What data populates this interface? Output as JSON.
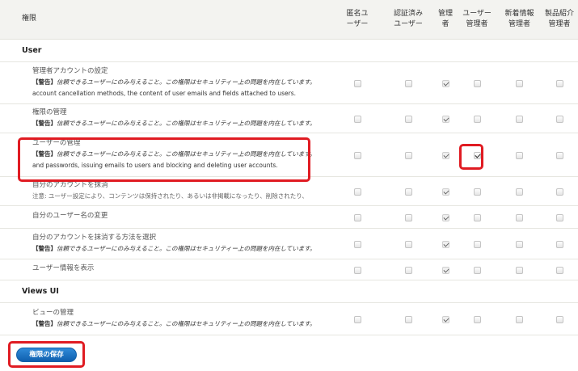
{
  "header": {
    "permission_label": "権限",
    "roles": [
      "匿名ユーザー",
      "認証済みユーザー",
      "管理者",
      "ユーザー管理者",
      "新着情報管理者",
      "製品紹介管理者"
    ]
  },
  "sections": [
    {
      "title": "User",
      "rows": [
        {
          "title": "管理者アカウントの設定",
          "warn_label": "【警告】",
          "warn_text": "信頼できるユーザーにのみ与えること。この権限はセキュリティー上の問題を内在しています。",
          "extra": "account cancellation methods, the content of user emails and fields attached to users.",
          "checks": [
            false,
            false,
            true,
            false,
            false,
            false
          ],
          "disabled": [
            false,
            false,
            true,
            false,
            false,
            false
          ]
        },
        {
          "title": "権限の管理",
          "warn_label": "【警告】",
          "warn_text": "信頼できるユーザーにのみ与えること。この権限はセキュリティー上の問題を内在しています。",
          "checks": [
            false,
            false,
            true,
            false,
            false,
            false
          ],
          "disabled": [
            false,
            false,
            true,
            false,
            false,
            false
          ]
        },
        {
          "title": "ユーザーの管理",
          "warn_label": "【警告】",
          "warn_text": "信頼できるユーザーにのみ与えること。この権限はセキュリティー上の問題を内在しています。",
          "extra": "and passwords, issuing emails to users and blocking and deleting user accounts.",
          "checks": [
            false,
            false,
            true,
            true,
            false,
            false
          ],
          "disabled": [
            false,
            false,
            true,
            false,
            false,
            false
          ]
        },
        {
          "title": "自分のアカウントを抹消",
          "note": "注意: ユーザー設定により、コンテンツは保持されたり、あるいは非掲載になったり、削除されたり、",
          "checks": [
            false,
            false,
            true,
            false,
            false,
            false
          ],
          "disabled": [
            false,
            false,
            true,
            false,
            false,
            false
          ]
        },
        {
          "title": "自分のユーザー名の変更",
          "checks": [
            false,
            false,
            true,
            false,
            false,
            false
          ],
          "disabled": [
            false,
            false,
            true,
            false,
            false,
            false
          ]
        },
        {
          "title": "自分のアカウントを抹消する方法を選択",
          "warn_label": "【警告】",
          "warn_text": "信頼できるユーザーにのみ与えること。この権限はセキュリティー上の問題を内在しています。",
          "checks": [
            false,
            false,
            true,
            false,
            false,
            false
          ],
          "disabled": [
            false,
            false,
            true,
            false,
            false,
            false
          ]
        },
        {
          "title": "ユーザー情報を表示",
          "checks": [
            false,
            false,
            true,
            false,
            false,
            false
          ],
          "disabled": [
            false,
            false,
            true,
            false,
            false,
            false
          ]
        }
      ]
    },
    {
      "title": "Views UI",
      "rows": [
        {
          "title": "ビューの管理",
          "warn_label": "【警告】",
          "warn_text": "信頼できるユーザーにのみ与えること。この権限はセキュリティー上の問題を内在しています。",
          "checks": [
            false,
            false,
            true,
            false,
            false,
            false
          ],
          "disabled": [
            false,
            false,
            true,
            false,
            false,
            false
          ]
        }
      ]
    }
  ],
  "save_button": {
    "label": "権限の保存"
  },
  "colors": {
    "highlight": "#e01b22",
    "button": "#1a6fbf"
  }
}
